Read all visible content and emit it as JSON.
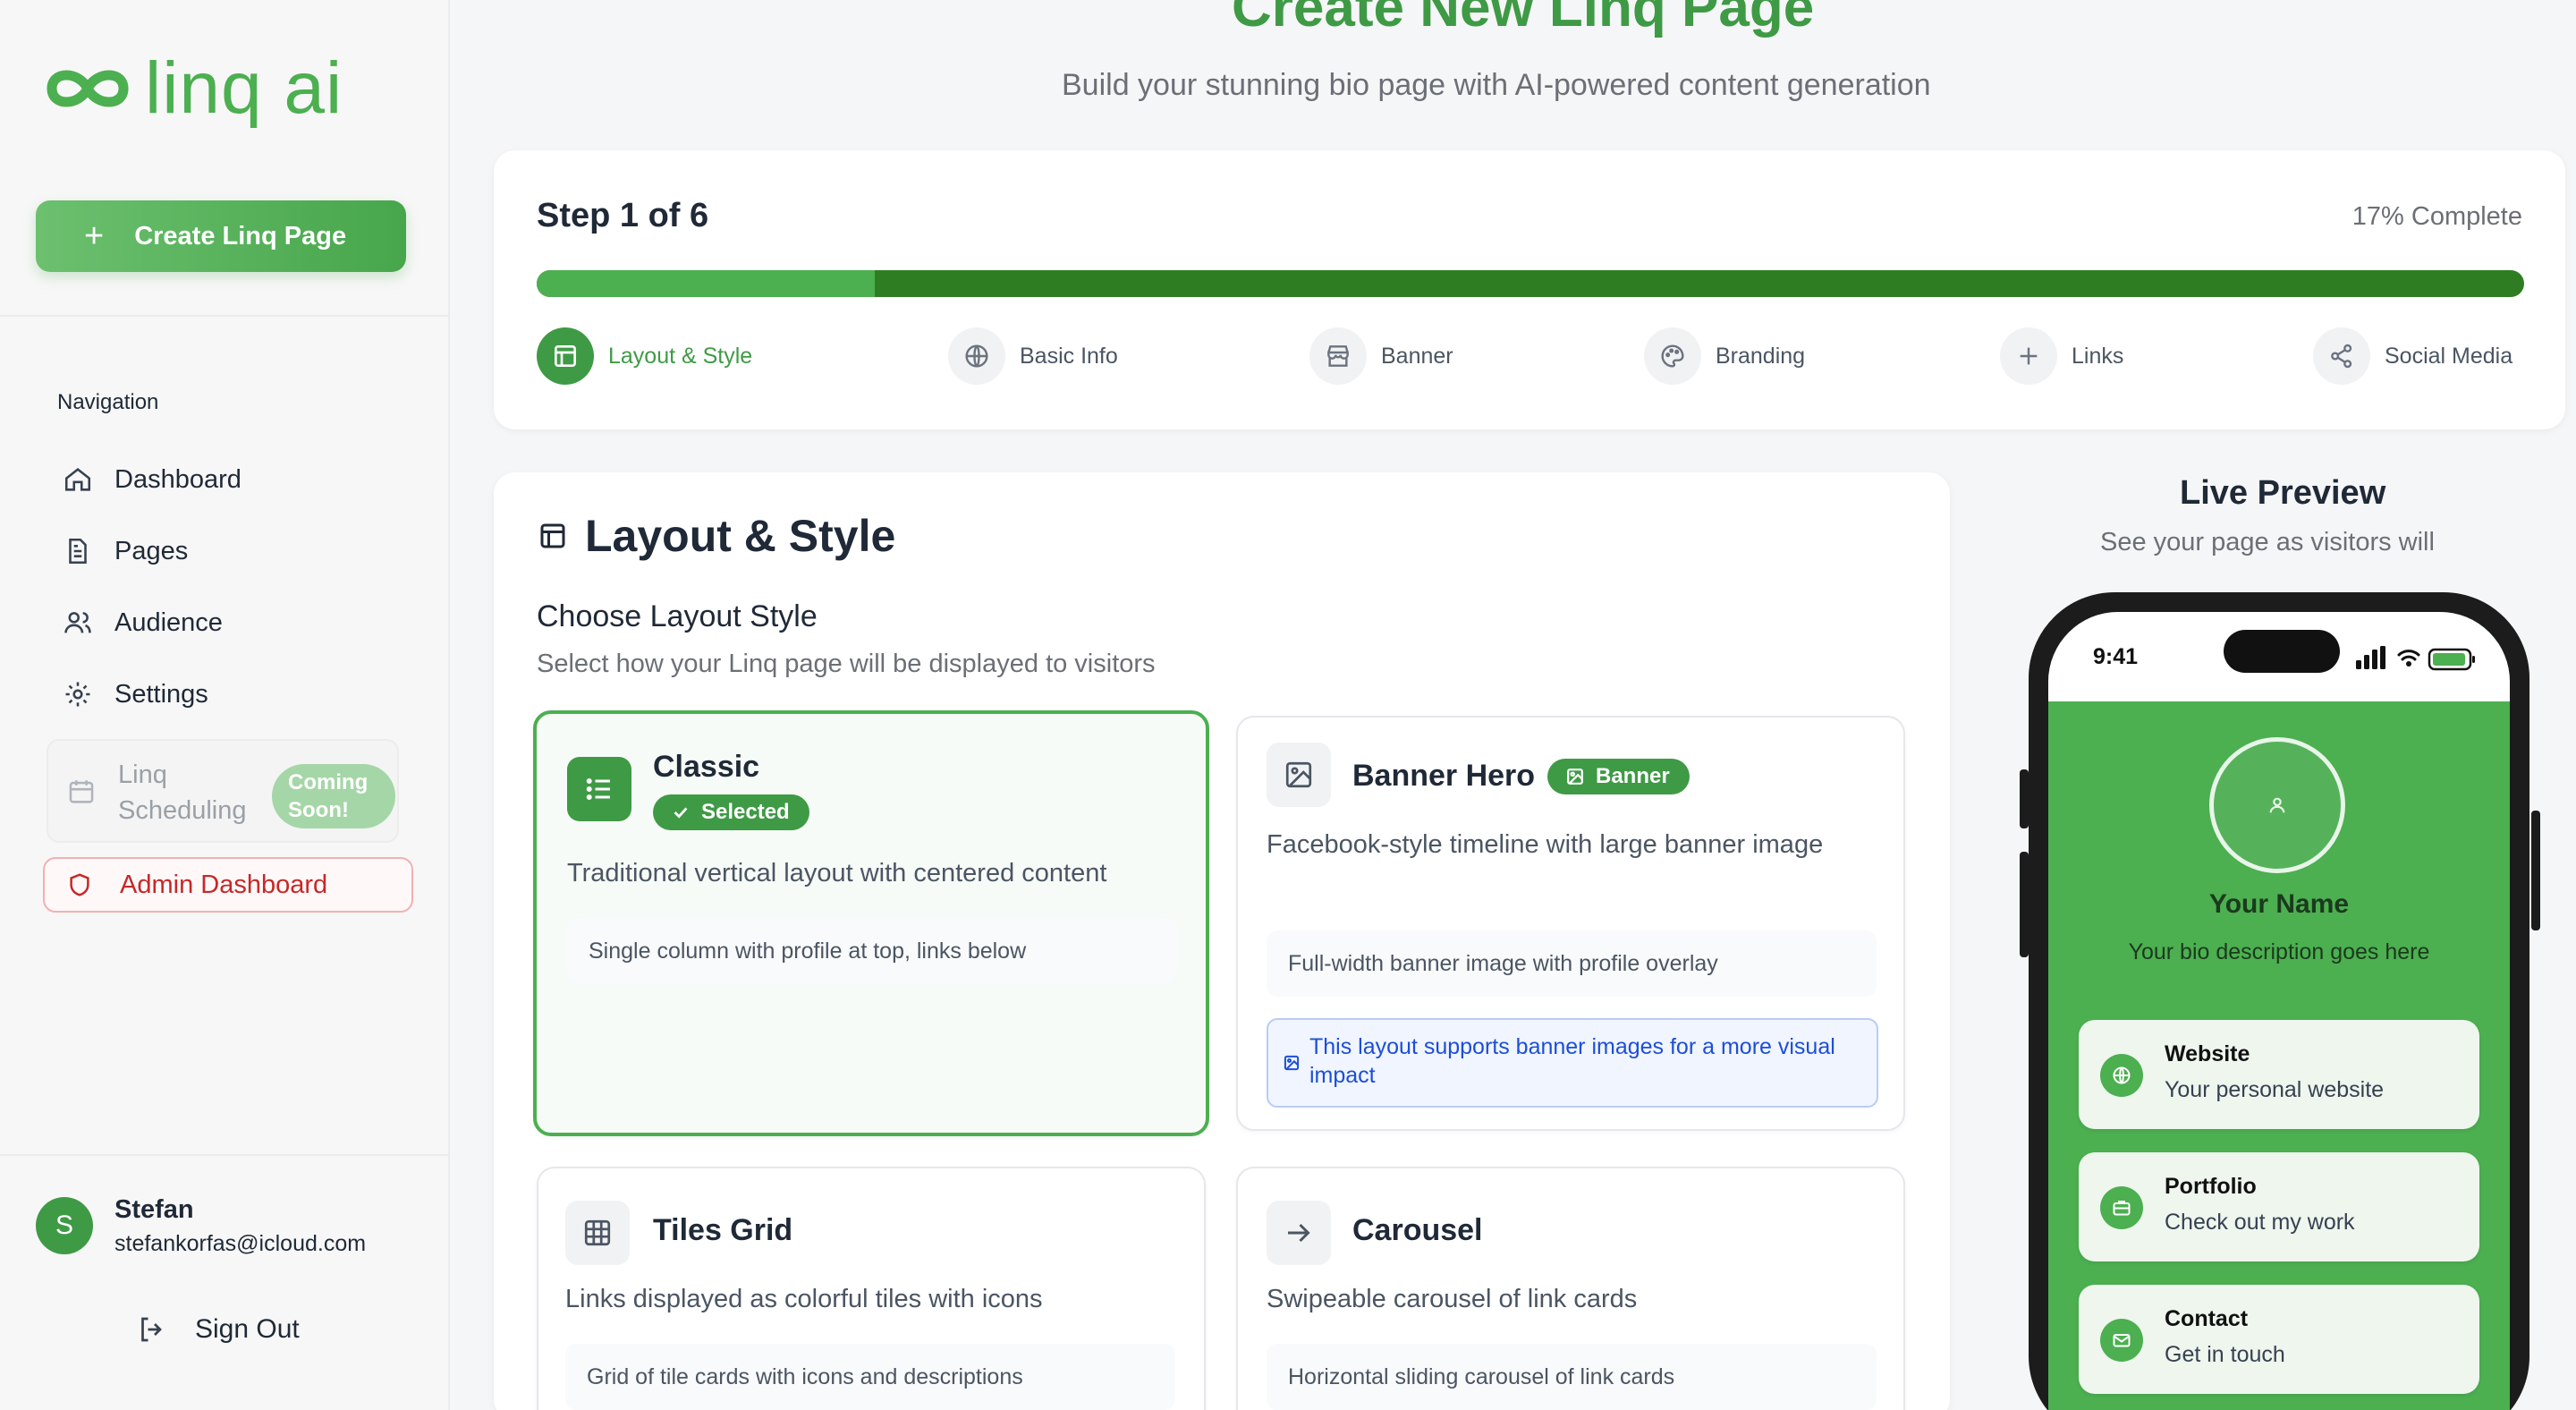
{
  "sidebar": {
    "logo_text": "linq ai",
    "create_button": "Create Linq Page",
    "nav_heading": "Navigation",
    "nav_items": [
      {
        "label": "Dashboard",
        "icon": "home-icon"
      },
      {
        "label": "Pages",
        "icon": "document-icon"
      },
      {
        "label": "Audience",
        "icon": "users-icon"
      },
      {
        "label": "Settings",
        "icon": "gear-icon"
      }
    ],
    "scheduling": {
      "label": "Linq Scheduling",
      "badge": "Coming Soon!"
    },
    "admin": "Admin Dashboard",
    "user": {
      "initial": "S",
      "name": "Stefan",
      "email": "stefankorfas@icloud.com"
    },
    "sign_out": "Sign Out"
  },
  "header": {
    "title": "Create New Linq Page",
    "subtitle": "Build your stunning bio page with AI-powered content generation"
  },
  "progress": {
    "step_label": "Step 1 of 6",
    "complete_label": "17% Complete",
    "fraction": 0.17,
    "steps": [
      {
        "label": "Layout & Style",
        "icon": "layout-icon",
        "active": true
      },
      {
        "label": "Basic Info",
        "icon": "globe-icon",
        "active": false
      },
      {
        "label": "Banner",
        "icon": "store-icon",
        "active": false
      },
      {
        "label": "Branding",
        "icon": "palette-icon",
        "active": false
      },
      {
        "label": "Links",
        "icon": "plus-icon",
        "active": false
      },
      {
        "label": "Social Media",
        "icon": "share-icon",
        "active": false
      }
    ]
  },
  "layout_card": {
    "title": "Layout & Style",
    "section_title": "Choose Layout Style",
    "section_desc": "Select how your Linq page will be displayed to visitors",
    "options": [
      {
        "name": "Classic",
        "badge": "Selected",
        "desc": "Traditional vertical layout with centered content",
        "detail": "Single column with profile at top, links below"
      },
      {
        "name": "Banner Hero",
        "badge": "Banner",
        "desc": "Facebook-style timeline with large banner image",
        "detail": "Full-width banner image with profile overlay",
        "info": "This layout supports banner images for a more visual impact"
      },
      {
        "name": "Tiles Grid",
        "desc": "Links displayed as colorful tiles with icons",
        "detail": "Grid of tile cards with icons and descriptions"
      },
      {
        "name": "Carousel",
        "desc": "Swipeable carousel of link cards",
        "detail": "Horizontal sliding carousel of link cards"
      }
    ]
  },
  "preview": {
    "title": "Live Preview",
    "subtitle": "See your page as visitors will",
    "time": "9:41",
    "name": "Your Name",
    "bio": "Your bio description goes here",
    "links": [
      {
        "title": "Website",
        "sub": "Your personal website",
        "icon": "globe-icon"
      },
      {
        "title": "Portfolio",
        "sub": "Check out my work",
        "icon": "briefcase-icon"
      },
      {
        "title": "Contact",
        "sub": "Get in touch",
        "icon": "mail-icon"
      }
    ]
  },
  "colors": {
    "brand": "#4caf50",
    "brand_dark": "#3f9a45",
    "progress_track": "#2e7d22",
    "danger": "#c62828",
    "info": "#1d4ed8"
  }
}
